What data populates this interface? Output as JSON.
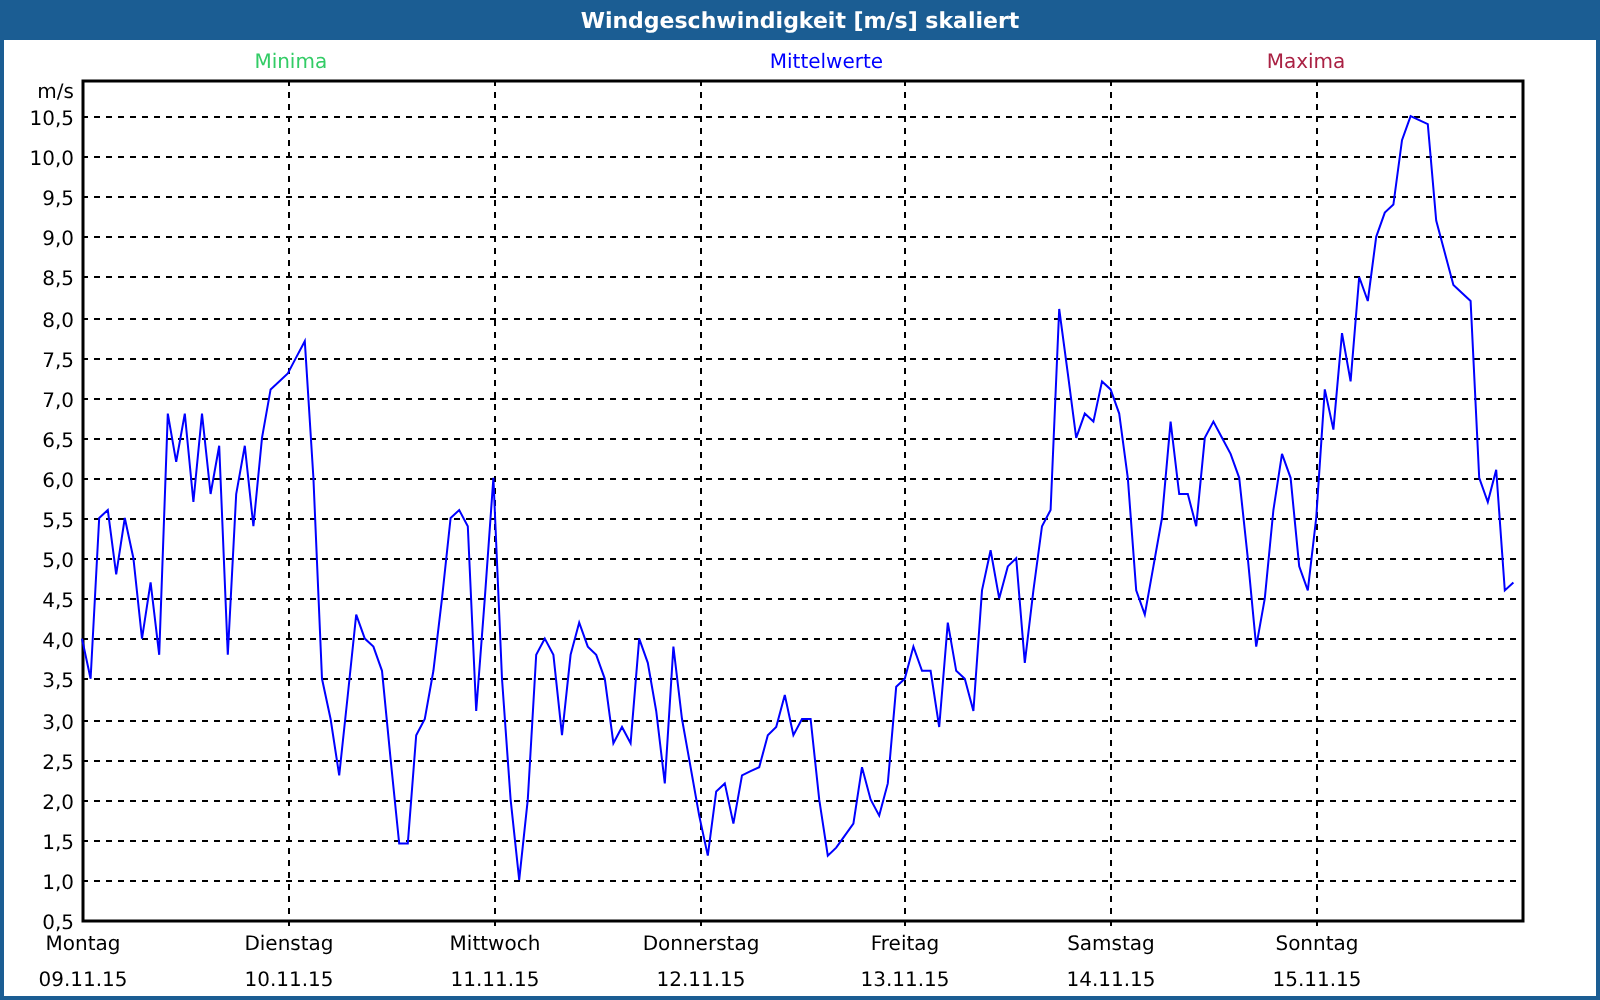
{
  "window": {
    "title": "Windgeschwindigkeit [m/s] skaliert"
  },
  "chart": {
    "legend": [
      {
        "label": "Minima",
        "color": "#33cc66"
      },
      {
        "label": "Maxima",
        "color": "#aa2244"
      }
    ],
    "chart_data": {
      "type": "line",
      "ylabel": "m/s",
      "grid": true,
      "ylim": [
        0.5,
        10.95
      ],
      "categories": [
        "Montag\n09.11.15",
        null,
        null,
        null,
        null,
        null,
        null,
        null,
        null,
        null,
        null,
        null,
        null,
        null,
        null,
        null,
        null,
        null,
        null,
        null,
        null,
        null,
        null,
        null,
        "Dienstag\n10.11.15",
        null,
        null,
        null,
        null,
        null,
        null,
        null,
        null,
        null,
        null,
        null,
        null,
        null,
        null,
        null,
        null,
        null,
        null,
        null,
        null,
        null,
        null,
        null,
        "Mittwoch\n11.11.15",
        null,
        null,
        null,
        null,
        null,
        null,
        null,
        null,
        null,
        null,
        null,
        null,
        null,
        null,
        null,
        null,
        null,
        null,
        null,
        null,
        null,
        null,
        null,
        "Donnerstag\n12.11.15",
        null,
        null,
        null,
        null,
        null,
        null,
        null,
        null,
        null,
        null,
        null,
        null,
        null,
        null,
        null,
        null,
        null,
        null,
        null,
        null,
        null,
        null,
        null,
        "Freitag\n13.11.15",
        null,
        null,
        null,
        null,
        null,
        null,
        null,
        null,
        null,
        null,
        null,
        null,
        null,
        null,
        null,
        null,
        null,
        null,
        null,
        null,
        null,
        null,
        null,
        "Samstag\n14.11.15",
        null,
        null,
        null,
        null,
        null,
        null,
        null,
        null,
        null,
        null,
        null,
        null,
        null,
        null,
        null,
        null,
        null,
        null,
        null,
        null,
        null,
        null,
        null,
        "Sonntag\n15.11.15",
        null,
        null,
        null,
        null,
        null,
        null,
        null,
        null,
        null,
        null,
        null,
        null,
        null,
        null,
        null,
        null,
        null,
        null,
        null,
        null,
        null,
        null,
        null
      ],
      "yticks": [
        {
          "value": 0.5,
          "label": "0,5"
        },
        {
          "value": 1,
          "label": "1,0"
        },
        {
          "value": 1.5,
          "label": "1,5"
        },
        {
          "value": 2,
          "label": "2,0"
        },
        {
          "value": 2.5,
          "label": "2,5"
        },
        {
          "value": 3,
          "label": "3,0"
        },
        {
          "value": 3.5,
          "label": "3,5"
        },
        {
          "value": 4,
          "label": "4,0"
        },
        {
          "value": 4.5,
          "label": "4,5"
        },
        {
          "value": 5,
          "label": "5,0"
        },
        {
          "value": 5.5,
          "label": "5,5"
        },
        {
          "value": 6,
          "label": "6,0"
        },
        {
          "value": 6.5,
          "label": "6,5"
        },
        {
          "value": 7,
          "label": "7,0"
        },
        {
          "value": 7.5,
          "label": "7,5"
        },
        {
          "value": 8,
          "label": "8,0"
        },
        {
          "value": 8.5,
          "label": "8,5"
        },
        {
          "value": 9,
          "label": "9,0"
        },
        {
          "value": 9.5,
          "label": "9,5"
        },
        {
          "value": 10,
          "label": "10,0"
        },
        {
          "value": 10.5,
          "label": "10,5"
        }
      ],
      "series": [
        {
          "name": "Mittelwerte",
          "color": "#0000ff",
          "values": [
            4.0,
            3.5,
            5.5,
            5.6,
            4.8,
            5.5,
            5.0,
            4.0,
            4.7,
            3.8,
            6.8,
            6.2,
            6.8,
            5.7,
            6.8,
            5.8,
            6.4,
            3.8,
            5.8,
            6.4,
            5.4,
            6.5,
            7.1,
            7.2,
            7.3,
            7.5,
            7.7,
            6.0,
            3.5,
            3.0,
            2.3,
            3.3,
            4.3,
            4.0,
            3.9,
            3.6,
            2.5,
            1.45,
            1.45,
            2.8,
            3.0,
            3.6,
            4.5,
            5.5,
            5.6,
            5.4,
            3.1,
            4.5,
            6.0,
            3.5,
            2.0,
            1.0,
            2.0,
            3.8,
            4.0,
            3.8,
            2.8,
            3.8,
            4.2,
            3.9,
            3.8,
            3.5,
            2.7,
            2.9,
            2.7,
            4.0,
            3.7,
            3.1,
            2.2,
            3.9,
            3.0,
            2.4,
            1.8,
            1.3,
            2.1,
            2.2,
            1.7,
            2.3,
            2.35,
            2.4,
            2.8,
            2.9,
            3.3,
            2.8,
            3.0,
            3.0,
            2.0,
            1.3,
            1.4,
            1.55,
            1.7,
            2.4,
            2.0,
            1.8,
            2.2,
            3.4,
            3.5,
            3.9,
            3.6,
            3.6,
            2.9,
            4.2,
            3.6,
            3.5,
            3.1,
            4.6,
            5.1,
            4.5,
            4.9,
            5.0,
            3.7,
            4.6,
            5.4,
            5.6,
            8.1,
            7.3,
            6.5,
            6.8,
            6.7,
            7.2,
            7.1,
            6.8,
            6.0,
            4.6,
            4.3,
            4.9,
            5.5,
            6.7,
            5.8,
            5.8,
            5.4,
            6.5,
            6.7,
            6.5,
            6.3,
            6.0,
            5.0,
            3.9,
            4.5,
            5.6,
            6.3,
            6.0,
            4.9,
            4.6,
            5.5,
            7.1,
            6.6,
            7.8,
            7.2,
            8.5,
            8.2,
            9.0,
            9.3,
            9.4,
            10.2,
            10.5,
            10.45,
            10.4,
            9.2,
            8.8,
            8.4,
            8.3,
            8.2,
            6.0,
            5.7,
            6.1,
            4.6,
            4.7
          ]
        }
      ]
    }
  }
}
